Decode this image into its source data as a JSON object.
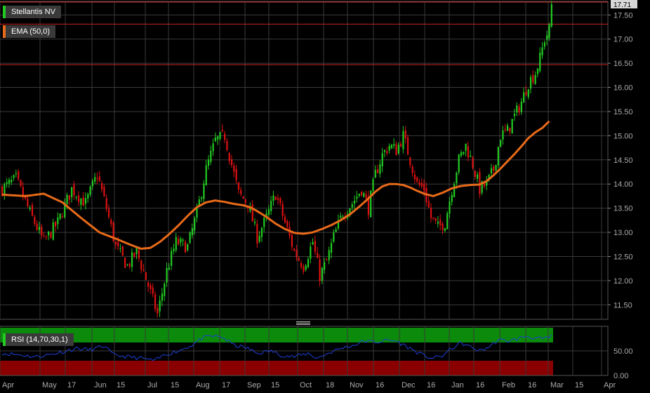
{
  "legend": {
    "price_label": "Stellantis NV",
    "ema_label": "EMA (50,0)",
    "rsi_label": "RSI (14,70,30,1)"
  },
  "colors": {
    "up": "#22cc22",
    "down": "#dd1111",
    "ema": "#e86a1a",
    "rsi": "#1f3fd6",
    "rsi_overbought_band": "#0b8a0b",
    "rsi_oversold_band": "#8a0000",
    "hline": "#cc2222",
    "grid": "#3a3a3a"
  },
  "chart_data": [
    {
      "type": "candlestick",
      "title": "Stellantis NV",
      "ylim": [
        11.2,
        17.78
      ],
      "y_ticks": [
        "11.50",
        "12.00",
        "12.50",
        "13.00",
        "13.50",
        "14.00",
        "14.50",
        "15.00",
        "15.50",
        "16.00",
        "16.50",
        "17.00",
        "17.50"
      ],
      "last_price": "17.71",
      "horizontal_lines": [
        17.31,
        16.47
      ],
      "x_labels": [
        "Apr",
        "May",
        "17",
        "Jun",
        "15",
        "Jul",
        "15",
        "Aug",
        "17",
        "Sep",
        "15",
        "Oct",
        "18",
        "Nov",
        "16",
        "Dec",
        "16",
        "Jan",
        "16",
        "Feb",
        "16",
        "Mar",
        "15",
        "Apr"
      ],
      "grid": true,
      "close_anchors": [
        [
          0,
          13.9
        ],
        [
          6,
          14.1
        ],
        [
          12,
          13.4
        ],
        [
          18,
          12.8
        ],
        [
          24,
          13.2
        ],
        [
          30,
          13.9
        ],
        [
          36,
          13.6
        ],
        [
          41,
          14.2
        ],
        [
          45,
          13.5
        ],
        [
          49,
          12.7
        ],
        [
          54,
          12.3
        ],
        [
          58,
          12.6
        ],
        [
          63,
          11.9
        ],
        [
          67,
          11.3
        ],
        [
          71,
          12.2
        ],
        [
          75,
          12.8
        ],
        [
          80,
          12.7
        ],
        [
          84,
          13.4
        ],
        [
          88,
          14.3
        ],
        [
          92,
          14.9
        ],
        [
          96,
          15.0
        ],
        [
          99,
          14.4
        ],
        [
          102,
          13.8
        ],
        [
          106,
          13.6
        ],
        [
          110,
          12.9
        ],
        [
          114,
          13.3
        ],
        [
          118,
          13.8
        ],
        [
          122,
          13.2
        ],
        [
          126,
          12.6
        ],
        [
          130,
          12.3
        ],
        [
          134,
          12.8
        ],
        [
          137,
          12.1
        ],
        [
          140,
          12.4
        ],
        [
          143,
          12.9
        ],
        [
          147,
          13.4
        ],
        [
          151,
          13.6
        ],
        [
          155,
          13.9
        ],
        [
          158,
          13.5
        ],
        [
          161,
          14.2
        ],
        [
          164,
          14.6
        ],
        [
          167,
          14.8
        ],
        [
          170,
          14.7
        ],
        [
          173,
          15.0
        ],
        [
          176,
          14.5
        ],
        [
          179,
          14.0
        ],
        [
          182,
          13.9
        ],
        [
          185,
          13.3
        ],
        [
          188,
          13.1
        ],
        [
          191,
          13.2
        ],
        [
          194,
          13.9
        ],
        [
          197,
          14.5
        ],
        [
          200,
          14.8
        ],
        [
          203,
          14.4
        ],
        [
          206,
          13.9
        ],
        [
          209,
          14.0
        ],
        [
          212,
          14.3
        ],
        [
          215,
          15.0
        ],
        [
          218,
          15.1
        ],
        [
          221,
          15.4
        ],
        [
          224,
          15.7
        ],
        [
          227,
          16.1
        ],
        [
          230,
          16.3
        ],
        [
          232,
          16.6
        ],
        [
          234,
          17.0
        ],
        [
          236,
          17.2
        ],
        [
          237,
          17.71
        ]
      ],
      "ema_50": [
        [
          0,
          13.78
        ],
        [
          10,
          13.75
        ],
        [
          18,
          13.8
        ],
        [
          26,
          13.62
        ],
        [
          34,
          13.3
        ],
        [
          42,
          13.0
        ],
        [
          50,
          12.85
        ],
        [
          55,
          12.75
        ],
        [
          60,
          12.66
        ],
        [
          64,
          12.68
        ],
        [
          68,
          12.8
        ],
        [
          72,
          12.96
        ],
        [
          76,
          13.14
        ],
        [
          80,
          13.34
        ],
        [
          84,
          13.52
        ],
        [
          88,
          13.62
        ],
        [
          92,
          13.66
        ],
        [
          96,
          13.63
        ],
        [
          100,
          13.59
        ],
        [
          104,
          13.56
        ],
        [
          107,
          13.52
        ],
        [
          110,
          13.44
        ],
        [
          114,
          13.32
        ],
        [
          118,
          13.18
        ],
        [
          122,
          13.07
        ],
        [
          126,
          12.99
        ],
        [
          130,
          12.97
        ],
        [
          134,
          13.0
        ],
        [
          138,
          13.07
        ],
        [
          142,
          13.15
        ],
        [
          146,
          13.25
        ],
        [
          150,
          13.37
        ],
        [
          154,
          13.53
        ],
        [
          158,
          13.7
        ],
        [
          161,
          13.84
        ],
        [
          164,
          13.95
        ],
        [
          167,
          14.0
        ],
        [
          170,
          14.0
        ],
        [
          173,
          13.98
        ],
        [
          176,
          13.93
        ],
        [
          179,
          13.86
        ],
        [
          182,
          13.8
        ],
        [
          186,
          13.75
        ],
        [
          190,
          13.82
        ],
        [
          194,
          13.91
        ],
        [
          198,
          13.96
        ],
        [
          202,
          13.98
        ],
        [
          206,
          13.99
        ],
        [
          209,
          14.06
        ],
        [
          212,
          14.18
        ],
        [
          215,
          14.32
        ],
        [
          218,
          14.47
        ],
        [
          221,
          14.62
        ],
        [
          224,
          14.78
        ],
        [
          227,
          14.95
        ],
        [
          230,
          15.07
        ],
        [
          233,
          15.16
        ],
        [
          236,
          15.3
        ]
      ]
    },
    {
      "type": "line",
      "title": "RSI (14,70,30,1)",
      "ylim": [
        0,
        100
      ],
      "y_ticks": [
        "0.00",
        "50.00"
      ],
      "bands": [
        {
          "from": 70,
          "to": 100,
          "name": "overbought"
        },
        {
          "from": 0,
          "to": 30,
          "name": "oversold"
        }
      ],
      "rsi_anchors": [
        [
          0,
          45
        ],
        [
          8,
          42
        ],
        [
          14,
          38
        ],
        [
          20,
          42
        ],
        [
          26,
          48
        ],
        [
          32,
          55
        ],
        [
          38,
          52
        ],
        [
          44,
          60
        ],
        [
          48,
          42
        ],
        [
          54,
          38
        ],
        [
          60,
          35
        ],
        [
          66,
          30
        ],
        [
          70,
          42
        ],
        [
          76,
          50
        ],
        [
          82,
          62
        ],
        [
          86,
          75
        ],
        [
          90,
          80
        ],
        [
          95,
          78
        ],
        [
          100,
          62
        ],
        [
          106,
          55
        ],
        [
          110,
          45
        ],
        [
          116,
          50
        ],
        [
          120,
          42
        ],
        [
          126,
          38
        ],
        [
          132,
          45
        ],
        [
          136,
          35
        ],
        [
          140,
          44
        ],
        [
          146,
          55
        ],
        [
          152,
          62
        ],
        [
          156,
          70
        ],
        [
          162,
          68
        ],
        [
          166,
          72
        ],
        [
          170,
          70
        ],
        [
          174,
          60
        ],
        [
          178,
          50
        ],
        [
          182,
          40
        ],
        [
          186,
          35
        ],
        [
          190,
          40
        ],
        [
          194,
          55
        ],
        [
          198,
          66
        ],
        [
          202,
          58
        ],
        [
          206,
          50
        ],
        [
          210,
          58
        ],
        [
          214,
          72
        ],
        [
          218,
          70
        ],
        [
          222,
          74
        ],
        [
          226,
          80
        ],
        [
          230,
          76
        ],
        [
          234,
          74
        ],
        [
          237,
          80
        ]
      ]
    }
  ]
}
